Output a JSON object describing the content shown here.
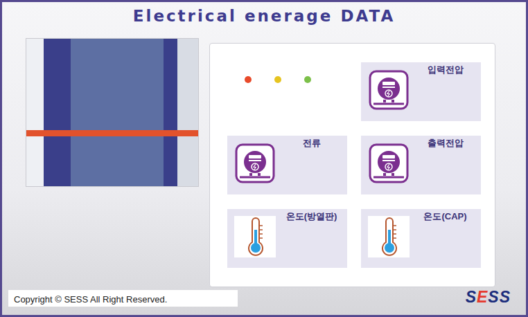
{
  "title": "Electrical enerage DATA",
  "status_lights": [
    {
      "color": "#e84a2a"
    },
    {
      "color": "#e6c420"
    },
    {
      "color": "#7cc04a"
    }
  ],
  "gauges": [
    {
      "label": "입력전압",
      "kind": "meter"
    },
    {
      "label": "전류",
      "kind": "meter"
    },
    {
      "label": "출력전압",
      "kind": "meter"
    },
    {
      "label": "온도(방열판)",
      "kind": "thermometer"
    },
    {
      "label": "온도(CAP)",
      "kind": "thermometer"
    }
  ],
  "footer": {
    "copyright": "Copyright © SESS All Right Reserved."
  },
  "logo": {
    "parts": [
      {
        "text": "S",
        "color": "#1c2d7c"
      },
      {
        "text": "E",
        "color": "#e53a2f"
      },
      {
        "text": "SS",
        "color": "#1c2d7c"
      }
    ]
  }
}
